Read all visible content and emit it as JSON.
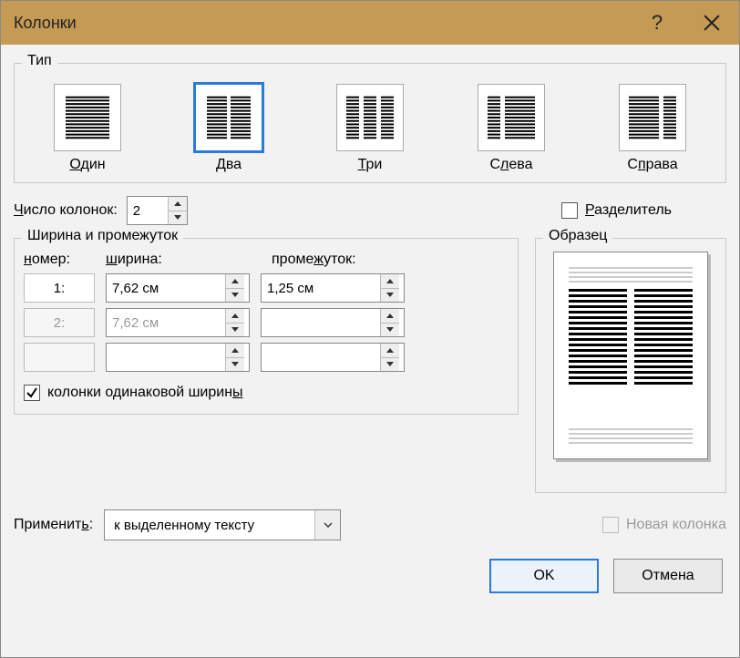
{
  "title": "Колонки",
  "groups": {
    "type_label": "Тип",
    "width_spacing_label": "Ширина и промежуток",
    "preview_label": "Образец"
  },
  "presets": [
    {
      "key": "one",
      "label_html": "<u>О</u>дин",
      "selected": false
    },
    {
      "key": "two",
      "label_html": "<u>Д</u>ва",
      "selected": true
    },
    {
      "key": "three",
      "label_html": "<u>Т</u>ри",
      "selected": false
    },
    {
      "key": "left",
      "label_html": "С<u>л</u>ева",
      "selected": false
    },
    {
      "key": "right",
      "label_html": "С<u>п</u>рава",
      "selected": false
    }
  ],
  "num_columns": {
    "label_html": "<u>Ч</u>исло колонок:",
    "value": "2"
  },
  "separator": {
    "label_html": "<u>Р</u>азделитель",
    "checked": false
  },
  "headers": {
    "number_html": "<u>н</u>омер:",
    "width_html": "<u>ш</u>ирина:",
    "spacing_html": "проме<u>ж</u>уток:"
  },
  "rows": [
    {
      "num": "1:",
      "width": "7,62 см",
      "spacing": "1,25 см",
      "enabled": true,
      "spacing_enabled": true
    },
    {
      "num": "2:",
      "width": "7,62 см",
      "spacing": "",
      "enabled": false,
      "spacing_enabled": false
    },
    {
      "num": "",
      "width": "",
      "spacing": "",
      "enabled": false,
      "spacing_enabled": false
    }
  ],
  "equal_width": {
    "label_html": "колонки одинаковой ширин<u>ы</u>",
    "checked": true
  },
  "apply": {
    "label_html": "Применит<u>ь</u>:",
    "value": "к выделенному тексту"
  },
  "new_column": {
    "label": "Новая колонка",
    "checked": false,
    "enabled": false
  },
  "buttons": {
    "ok": "OK",
    "cancel": "Отмена"
  }
}
